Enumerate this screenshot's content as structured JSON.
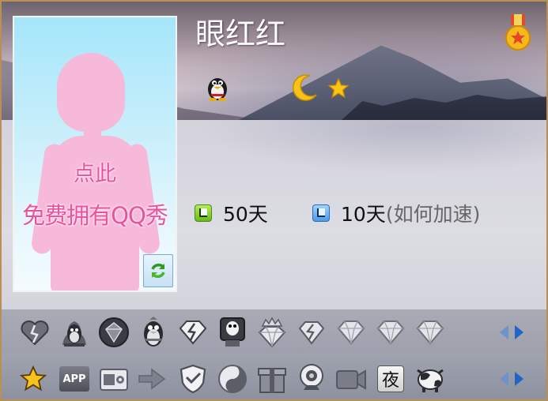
{
  "profile": {
    "nickname": "眼红红",
    "avatar_promo_line1": "点此",
    "avatar_promo_line2": "免费拥有QQ秀"
  },
  "stats": {
    "active_days": "50天",
    "boost_days": "10天",
    "boost_hint": "(如何加速)"
  },
  "header_icons": [
    "penguin-icon",
    "moon-icon",
    "star-icon",
    "medal-icon"
  ],
  "strip1_icons": [
    "heart-broken-icon",
    "qq-penguin-flame-icon",
    "diamond-dark-icon",
    "qq-penguin-icon",
    "diamond-bolt-icon",
    "penguin-computer-icon",
    "crown-diamond-icon",
    "diamond-bolt-small-icon",
    "diamond-icon",
    "diamond-icon",
    "diamond-icon"
  ],
  "strip2_icons": [
    "star-icon",
    "app-icon",
    "camera-box-icon",
    "arrow-gear-icon",
    "shield-check-icon",
    "swirl-icon",
    "gift-box-icon",
    "webcam-icon",
    "video-camera-icon",
    "night-mode-icon",
    "cow-icon"
  ],
  "labels": {
    "app_icon_text": "APP",
    "night_icon_text": "夜"
  },
  "colors": {
    "border": "#b98f56",
    "promo_pink": "#ee4f9e",
    "arrow_blue": "#1f64c7"
  }
}
